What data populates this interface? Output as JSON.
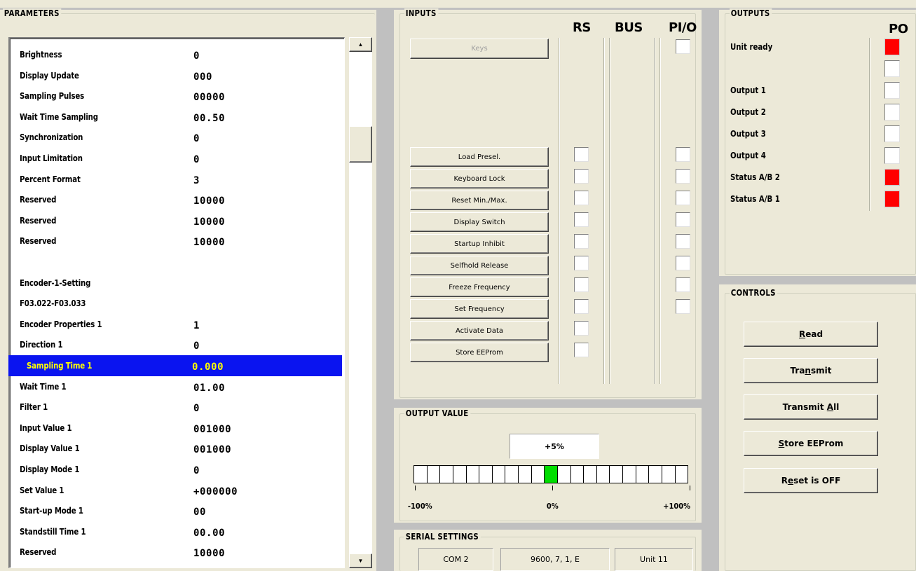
{
  "parameters": {
    "title": "PARAMETERS",
    "rows": [
      {
        "name": "Brightness",
        "value": "0"
      },
      {
        "name": "Display Update",
        "value": "000"
      },
      {
        "name": "Sampling Pulses",
        "value": "00000"
      },
      {
        "name": "Wait Time Sampling",
        "value": "00.50"
      },
      {
        "name": "Synchronization",
        "value": "0"
      },
      {
        "name": "Input Limitation",
        "value": "0"
      },
      {
        "name": "Percent Format",
        "value": "3"
      },
      {
        "name": "Reserved",
        "value": "10000"
      },
      {
        "name": "Reserved",
        "value": "10000"
      },
      {
        "name": "Reserved",
        "value": "10000"
      },
      {
        "name": "",
        "value": ""
      },
      {
        "name": "Encoder-1-Setting",
        "value": ""
      },
      {
        "name": "F03.022-F03.033",
        "value": ""
      },
      {
        "name": "Encoder Properties 1",
        "value": "1"
      },
      {
        "name": "Direction 1",
        "value": "0"
      },
      {
        "name": "Sampling Time 1",
        "value": "0.000",
        "selected": true
      },
      {
        "name": "Wait Time 1",
        "value": "01.00"
      },
      {
        "name": "Filter 1",
        "value": "0"
      },
      {
        "name": "Input Value 1",
        "value": "001000"
      },
      {
        "name": "Display Value 1",
        "value": "001000"
      },
      {
        "name": "Display Mode 1",
        "value": "0"
      },
      {
        "name": "Set Value 1",
        "value": "+000000"
      },
      {
        "name": "Start-up Mode 1",
        "value": "00"
      },
      {
        "name": "Standstill Time 1",
        "value": "00.00"
      },
      {
        "name": "Reserved",
        "value": "10000"
      }
    ]
  },
  "inputs": {
    "title": "INPUTS",
    "columns": [
      "RS",
      "BUS",
      "PI/O"
    ],
    "keys_label": "Keys",
    "buttons": [
      {
        "label": "Load Presel.",
        "rs": true,
        "pio": true
      },
      {
        "label": "Keyboard Lock",
        "rs": true,
        "pio": true
      },
      {
        "label": "Reset Min./Max.",
        "rs": true,
        "pio": true
      },
      {
        "label": "Display Switch",
        "rs": true,
        "pio": true
      },
      {
        "label": "Startup Inhibit",
        "rs": true,
        "pio": true
      },
      {
        "label": "Selfhold Release",
        "rs": true,
        "pio": true
      },
      {
        "label": "Freeze Frequency",
        "rs": true,
        "pio": true
      },
      {
        "label": "Set Frequency",
        "rs": true,
        "pio": true
      },
      {
        "label": "Activate Data",
        "rs": true,
        "pio": false
      },
      {
        "label": "Store EEProm",
        "rs": true,
        "pio": false
      }
    ]
  },
  "outputs": {
    "title": "OUTPUTS",
    "column": "PO",
    "items": [
      {
        "label": "Unit ready",
        "state": "red"
      },
      {
        "label": "",
        "state": "white"
      },
      {
        "label": "Output 1",
        "state": "white"
      },
      {
        "label": "Output 2",
        "state": "white"
      },
      {
        "label": "Output 3",
        "state": "white"
      },
      {
        "label": "Output 4",
        "state": "white"
      },
      {
        "label": "Status A/B 2",
        "state": "red"
      },
      {
        "label": "Status A/B 1",
        "state": "red"
      }
    ]
  },
  "controls": {
    "title": "CONTROLS",
    "read": {
      "pre": "",
      "u": "R",
      "post": "ead"
    },
    "transmit": {
      "pre": "Tra",
      "u": "n",
      "post": "smit"
    },
    "transmit_all": {
      "pre": "Transmit ",
      "u": "A",
      "post": "ll"
    },
    "store": {
      "pre": "",
      "u": "S",
      "post": "tore EEProm"
    },
    "reset": {
      "pre": "R",
      "u": "e",
      "post": "set is OFF"
    }
  },
  "output_value": {
    "title": "OUTPUT VALUE",
    "value_text": "+5%",
    "scale_min": "-100%",
    "scale_mid": "0%",
    "scale_max": "+100%",
    "segments": 21,
    "active_segment": 10,
    "value_percent": 5
  },
  "serial": {
    "title": "SERIAL SETTINGS",
    "port": "COM 2",
    "params": "9600, 7, 1, E",
    "unit": "Unit 11"
  },
  "colors": {
    "selection": "#0a14f0",
    "selection_text": "#ffff00",
    "indicator_red": "#ff0000",
    "bar_active": "#00dd00"
  }
}
